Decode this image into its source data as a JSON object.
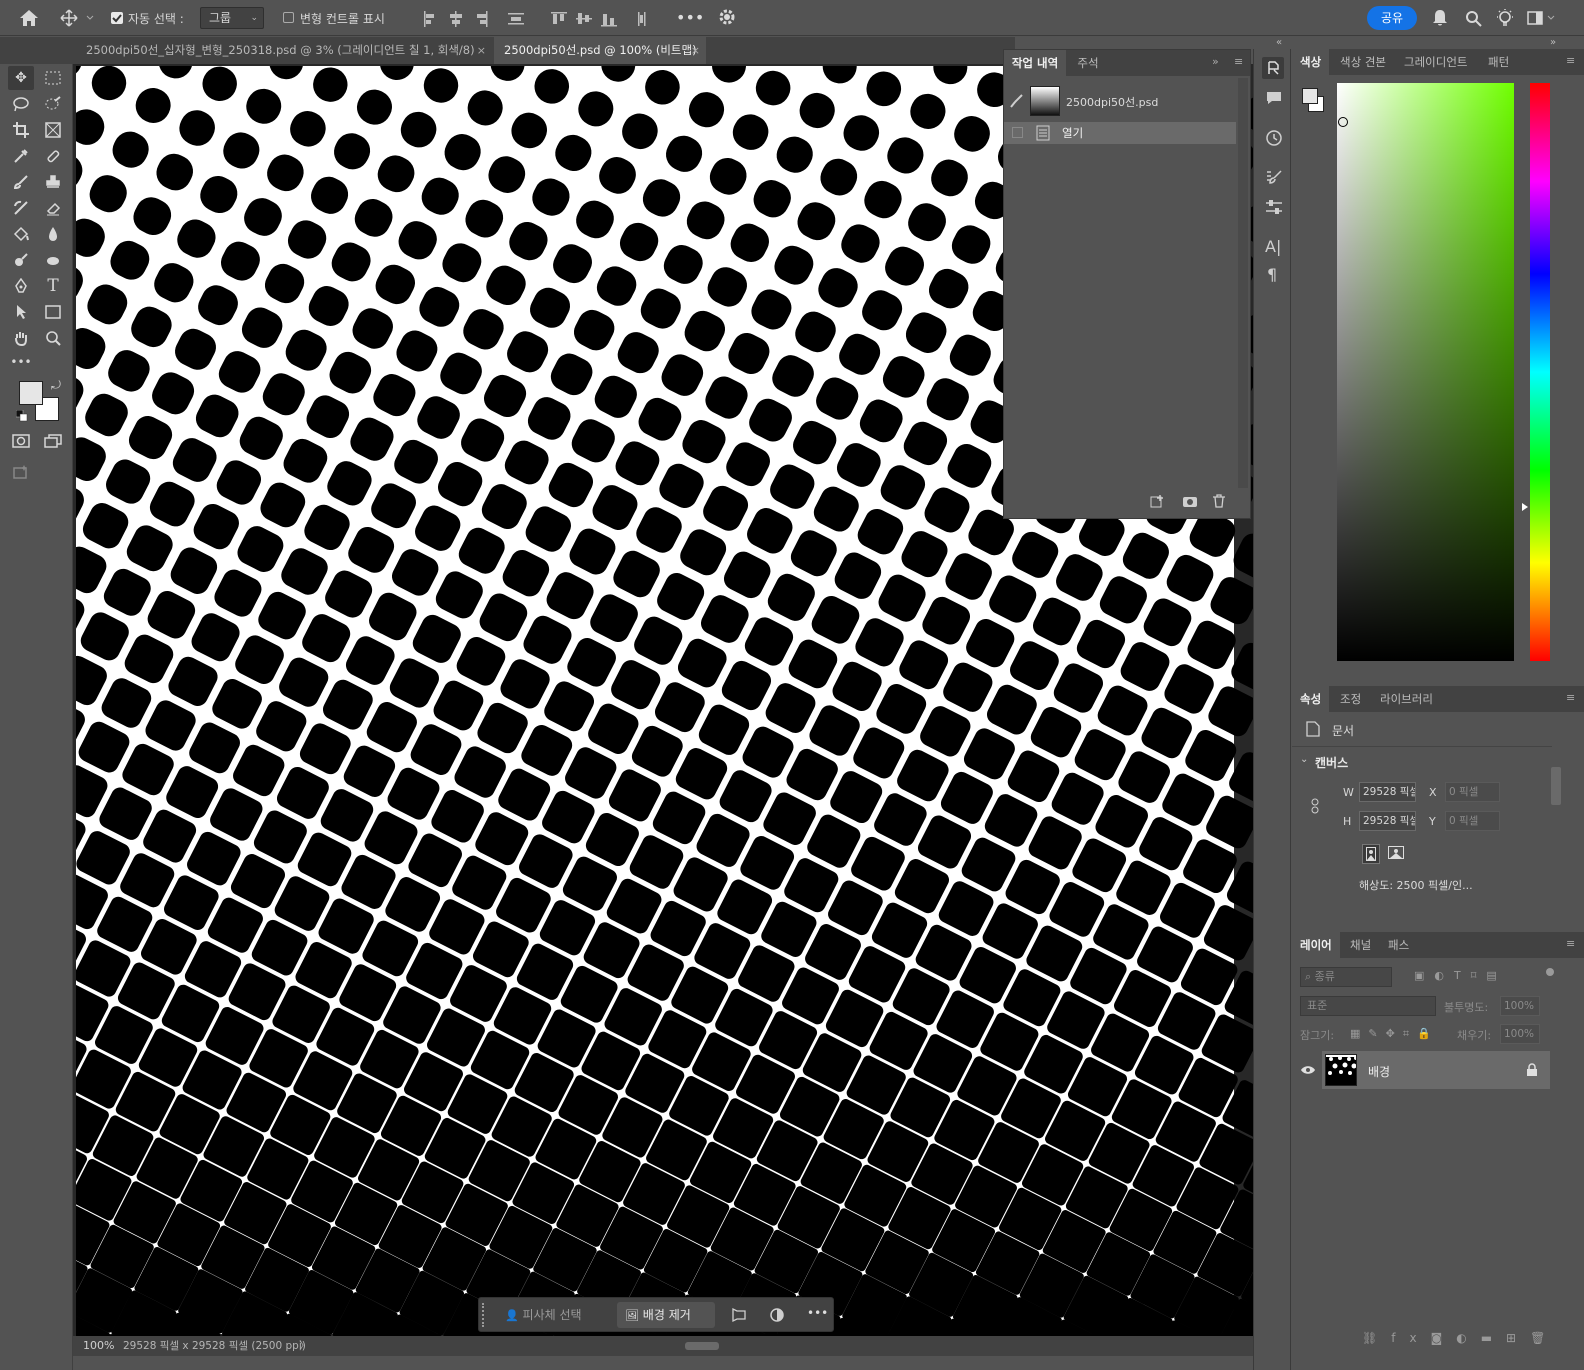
{
  "options_bar": {
    "auto_select_label": "자동 선택 :",
    "auto_select_value": "그룹",
    "transform_controls_label": "변형 컨트롤 표시",
    "share_label": "공유"
  },
  "tabs": [
    {
      "label": "2500dpi50선_십자형_변형_250318.psd @ 3% (그레이디언트 칠 1, 회색/8)"
    },
    {
      "label": "2500dpi50선.psd @ 100% (비트맵)"
    }
  ],
  "history_panel": {
    "tabs": [
      "작업 내역",
      "주석"
    ],
    "snapshot_name": "2500dpi50선.psd",
    "steps": [
      "열기"
    ]
  },
  "color_panel": {
    "tabs": [
      "색상",
      "색상 견본",
      "그레이디언트",
      "패턴"
    ],
    "hue_color": "#6fff00"
  },
  "properties_panel": {
    "tabs": [
      "속성",
      "조정",
      "라이브러리"
    ],
    "doc_label": "문서",
    "section": "캔버스",
    "w_label": "W",
    "h_label": "H",
    "x_label": "X",
    "y_label": "Y",
    "w_value": "29528 픽셀",
    "h_value": "29528 픽셀",
    "x_value": "0 픽셀",
    "y_value": "0 픽셀",
    "resolution": "해상도: 2500 픽셀/인..."
  },
  "layers_panel": {
    "tabs": [
      "레이어",
      "채널",
      "패스"
    ],
    "filter_placeholder": "종류",
    "blend_mode": "표준",
    "opacity_label": "불투명도:",
    "opacity_value": "100%",
    "lock_label": "잠그기:",
    "fill_label": "채우기:",
    "fill_value": "100%",
    "layer_name": "배경"
  },
  "status": {
    "zoom": "100%",
    "doc_info": "29528 픽셀 x 29528 픽셀 (2500 ppi)"
  },
  "contextual_bar": {
    "select_subject": "피사체 선택",
    "remove_background": "배경 제거"
  }
}
